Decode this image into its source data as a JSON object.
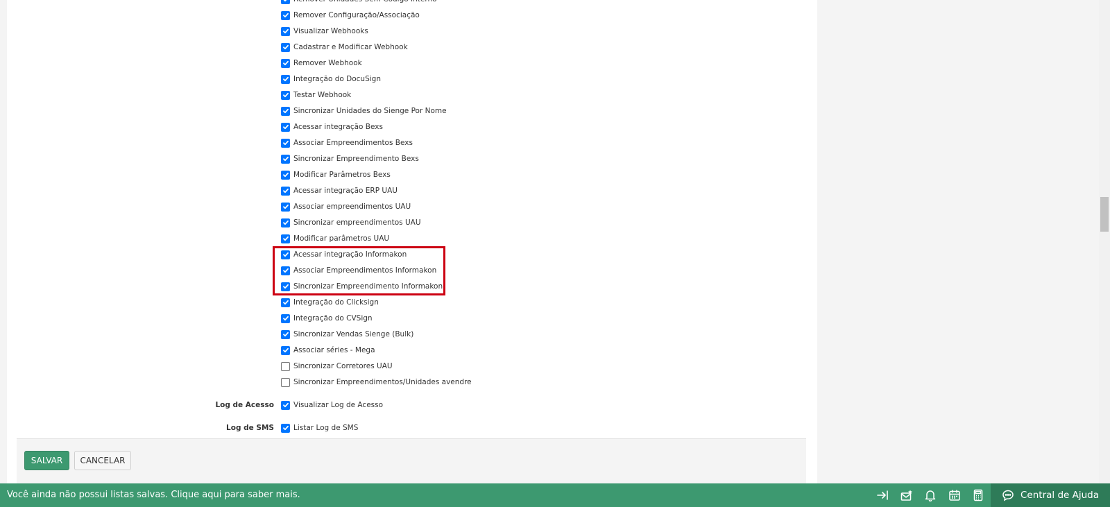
{
  "permissions": [
    {
      "label": "Remover Unidades Sem Código Interno",
      "checked": true
    },
    {
      "label": "Remover Configuração/Associação",
      "checked": true
    },
    {
      "label": "Visualizar Webhooks",
      "checked": true
    },
    {
      "label": "Cadastrar e Modificar Webhook",
      "checked": true
    },
    {
      "label": "Remover Webhook",
      "checked": true
    },
    {
      "label": "Integração do DocuSign",
      "checked": true
    },
    {
      "label": "Testar Webhook",
      "checked": true
    },
    {
      "label": "Sincronizar Unidades do Sienge Por Nome",
      "checked": true
    },
    {
      "label": "Acessar integração Bexs",
      "checked": true
    },
    {
      "label": "Associar Empreendimentos Bexs",
      "checked": true
    },
    {
      "label": "Sincronizar Empreendimento Bexs",
      "checked": true
    },
    {
      "label": "Modificar Parâmetros Bexs",
      "checked": true
    },
    {
      "label": "Acessar integração ERP UAU",
      "checked": true
    },
    {
      "label": "Associar empreendimentos UAU",
      "checked": true
    },
    {
      "label": "Sincronizar empreendimentos UAU",
      "checked": true
    },
    {
      "label": "Modificar parâmetros UAU",
      "checked": true
    },
    {
      "label": "Acessar integração Informakon",
      "checked": true
    },
    {
      "label": "Associar Empreendimentos Informakon",
      "checked": true
    },
    {
      "label": "Sincronizar Empreendimento Informakon",
      "checked": true
    },
    {
      "label": "Integração do Clicksign",
      "checked": true
    },
    {
      "label": "Integração do CVSign",
      "checked": true
    },
    {
      "label": "Sincronizar Vendas Sienge (Bulk)",
      "checked": true
    },
    {
      "label": "Associar séries - Mega",
      "checked": true
    },
    {
      "label": "Sincronizar Corretores UAU",
      "checked": false
    },
    {
      "label": "Sincronizar Empreendimentos/Unidades avendre",
      "checked": false
    }
  ],
  "groups": [
    {
      "title": "Log de Acesso",
      "items": [
        {
          "label": "Visualizar Log de Acesso",
          "checked": true
        }
      ]
    },
    {
      "title": "Log de SMS",
      "items": [
        {
          "label": "Listar Log de SMS",
          "checked": true
        }
      ]
    }
  ],
  "buttons": {
    "save": "SALVAR",
    "cancel": "CANCELAR"
  },
  "bottom_bar": {
    "message": "Você ainda não possui listas salvas. Clique aqui para saber mais.",
    "help_label": "Central de Ajuda"
  },
  "colors": {
    "accent": "#3d9970",
    "checkbox": "#0075ff",
    "highlight": "#cc0011"
  }
}
